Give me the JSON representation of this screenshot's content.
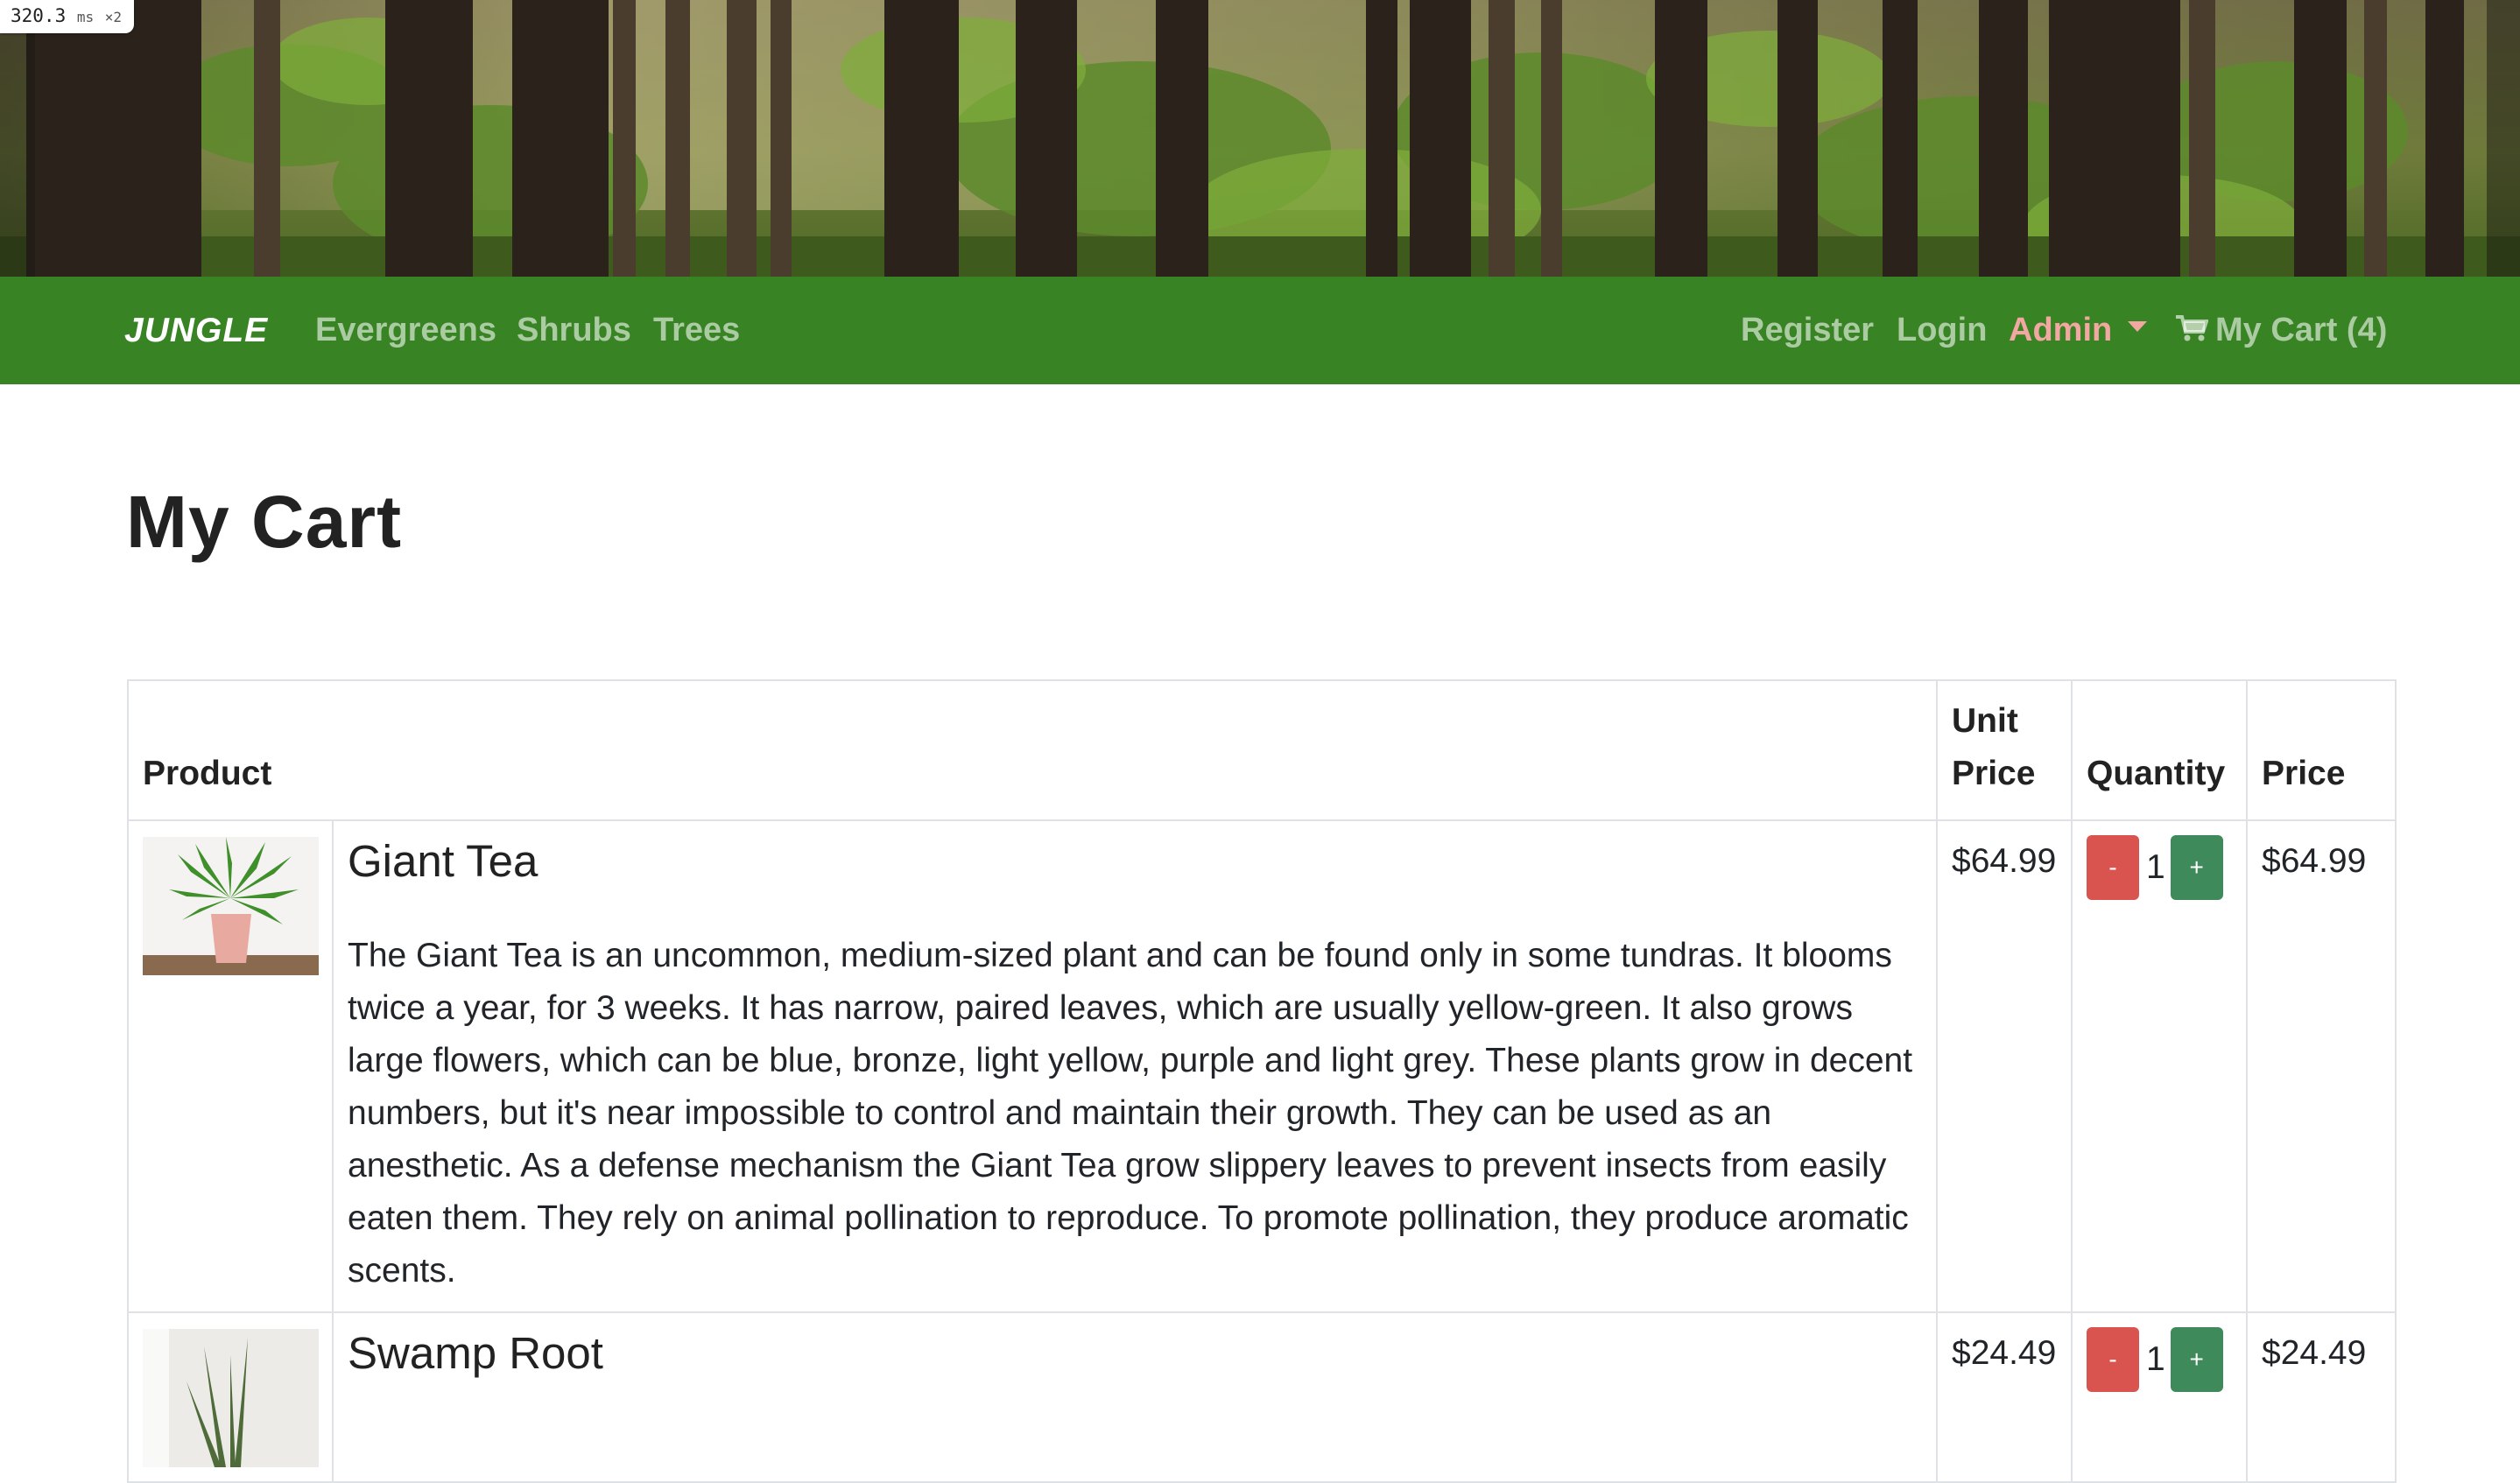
{
  "perf": {
    "value": "320.3",
    "unit": "ms",
    "multiplier": "×2"
  },
  "navbar": {
    "brand": "JUNGLE",
    "links": [
      "Evergreens",
      "Shrubs",
      "Trees"
    ],
    "register": "Register",
    "login": "Login",
    "admin": "Admin",
    "cart": "My Cart (4)"
  },
  "page": {
    "title": "My Cart"
  },
  "table": {
    "headers": {
      "product": "Product",
      "unit_price": "Unit Price",
      "quantity": "Quantity",
      "price": "Price"
    },
    "rows": [
      {
        "name": "Giant Tea",
        "description": "The Giant Tea is an uncommon, medium-sized plant and can be found only in some tundras. It blooms twice a year, for 3 weeks. It has narrow, paired leaves, which are usually yellow-green. It also grows large flowers, which can be blue, bronze, light yellow, purple and light grey. These plants grow in decent numbers, but it's near impossible to control and maintain their growth. They can be used as an anesthetic. As a defense mechanism the Giant Tea grow slippery leaves to prevent insects from easily eaten them. They rely on animal pollination to reproduce. To promote pollination, they produce aromatic scents.",
        "unit_price": "$64.99",
        "quantity": "1",
        "price": "$64.99",
        "minus": "-",
        "plus": "+"
      },
      {
        "name": "Swamp Root",
        "description": "",
        "unit_price": "$24.49",
        "quantity": "1",
        "price": "$24.49",
        "minus": "-",
        "plus": "+"
      }
    ]
  },
  "colors": {
    "navbar": "#388323",
    "admin": "#f3a7a2",
    "minus_button": "#d9534f",
    "plus_button": "#3f8a5a"
  },
  "icons": [
    "cart-icon",
    "caret-down-icon"
  ]
}
